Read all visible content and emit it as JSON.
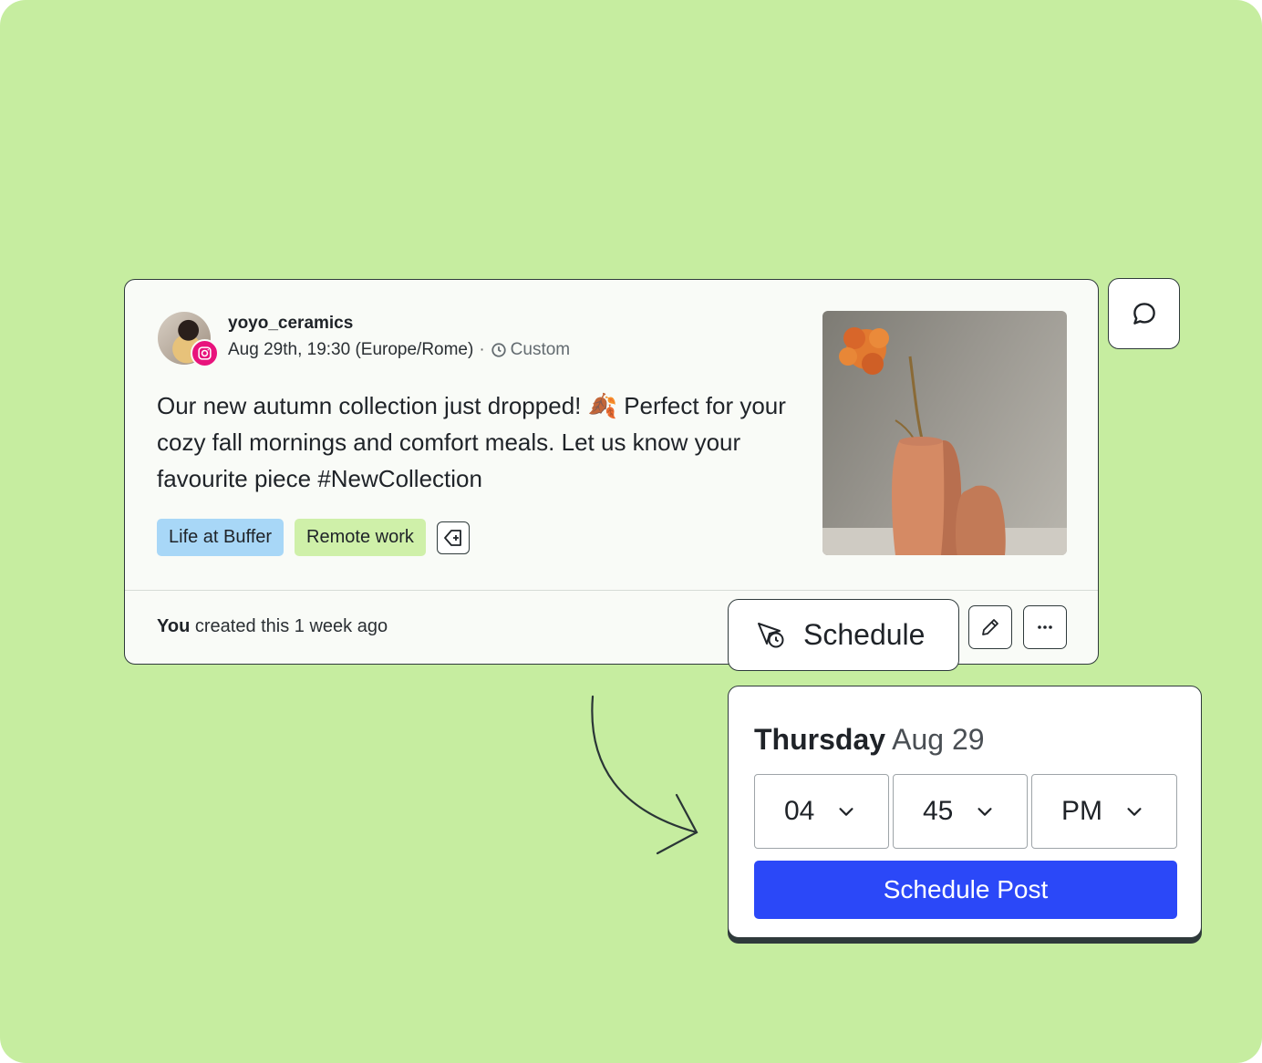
{
  "post": {
    "username": "yoyo_ceramics",
    "datetime": "Aug 29th, 19:30 (Europe/Rome)",
    "separator": "·",
    "schedule_type": "Custom",
    "text": "Our new autumn collection just dropped! 🍂 Perfect for your cozy fall mornings and comfort meals. Let us know your favourite piece #NewCollection",
    "tags": [
      {
        "label": "Life at Buffer",
        "color": "#a8d7f7"
      },
      {
        "label": "Remote work",
        "color": "#cff0a9"
      }
    ],
    "network": "instagram-icon",
    "image": "ceramic-vases-photo"
  },
  "footer": {
    "creator": "You",
    "created_text": " created this 1 week ago",
    "schedule_label": "Schedule"
  },
  "popup": {
    "weekday": "Thursday",
    "date": "Aug 29",
    "hour": "04",
    "minute": "45",
    "meridiem": "PM",
    "submit_label": "Schedule Post"
  },
  "colors": {
    "background": "#c6eda0",
    "primary": "#2b48f8",
    "instagram": "#e8137c"
  }
}
